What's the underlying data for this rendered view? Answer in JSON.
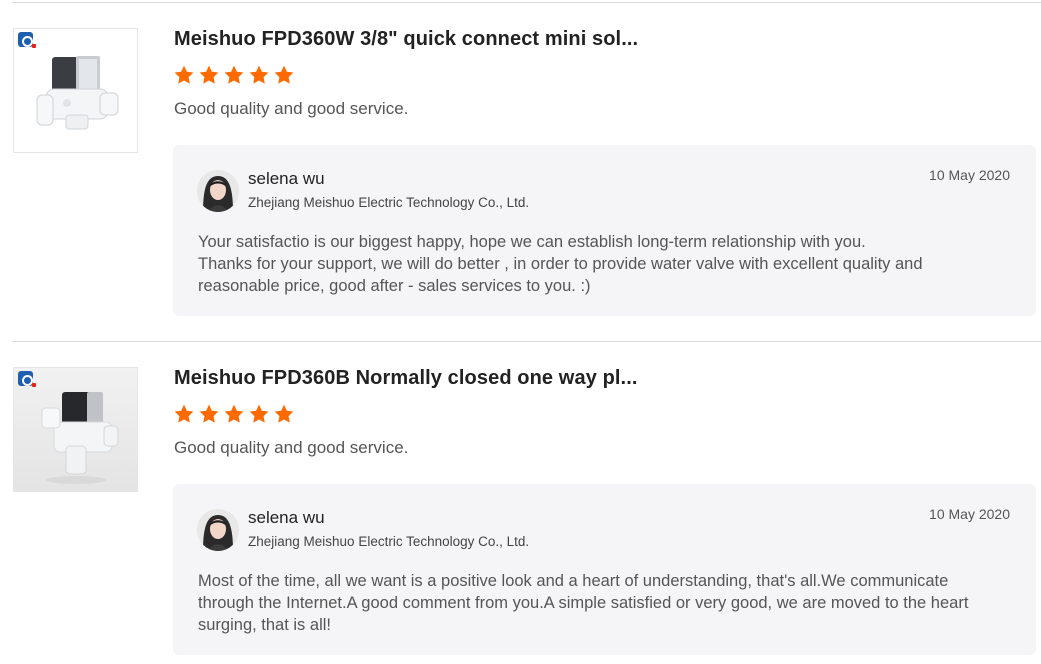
{
  "reviews": [
    {
      "product_title": "Meishuo FPD360W 3/8\" quick connect mini sol...",
      "rating": 5,
      "rating_max": 5,
      "comment": "Good quality and good service.",
      "reply": {
        "seller_name": "selena wu",
        "company": "Zhejiang Meishuo Electric Technology Co., Ltd.",
        "date": "10 May 2020",
        "text": "Your satisfactio is our biggest happy, hope we can establish long-term relationship with you.\nThanks for your support, we will do better , in order to provide water valve with excellent quality and reasonable price, good after - sales services to you. :)"
      }
    },
    {
      "product_title": "Meishuo FPD360B Normally closed one way pl...",
      "rating": 5,
      "rating_max": 5,
      "comment": "Good quality and good service.",
      "reply": {
        "seller_name": "selena wu",
        "company": "Zhejiang Meishuo Electric Technology Co., Ltd.",
        "date": "10 May 2020",
        "text": "Most of the time, all we want is a positive look and a heart of understanding, that's all.We communicate through the Internet.A good comment from you.A simple satisfied or very good, we are moved to the heart surging, that is all!"
      }
    }
  ],
  "colors": {
    "star": "#ff6a00",
    "reply_bg": "#f5f5f7",
    "divider": "#dcdcdc"
  },
  "icons": {
    "star": "star-icon",
    "brand": "brand-logo-icon"
  }
}
